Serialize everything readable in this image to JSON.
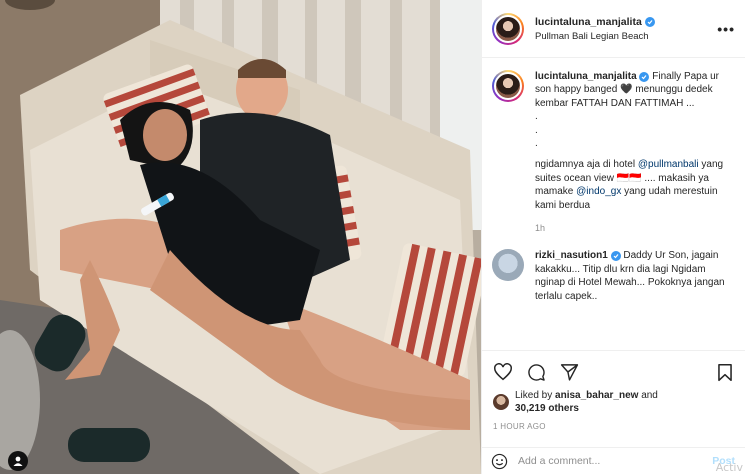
{
  "post": {
    "username": "lucintaluna_manjalita",
    "location": "Pullman Bali Legian Beach",
    "more_icon": "more-dots-icon"
  },
  "caption": {
    "username": "lucintaluna_manjalita",
    "line1": "Finally Papa ur son happy banged",
    "heart": "🖤",
    "line2": "menunggu dedek kembar FATTAH DAN FATTIMAH ...",
    "dots": [
      ".",
      ".",
      "."
    ],
    "p2_a": "ngidamnya aja di hotel",
    "mention1": "@pullmanbali",
    "p2_b": "yang suites ocean view",
    "flags": "🇮🇩🇮🇩",
    "p2_c": ".... makasih ya mamake",
    "mention2": "@indo_gx",
    "p2_d": "yang udah merestuin kami berdua",
    "time": "1h"
  },
  "comment1": {
    "username": "rizki_nasution1",
    "text": "Daddy Ur Son, jagain kakakku... Titip dlu krn dia lagi Ngidam nginap di Hotel Mewah... Pokoknya jangan terlalu capek.."
  },
  "likes": {
    "prefix": "Liked by",
    "by_user": "anisa_bahar_new",
    "and": "and",
    "count": "30,219 others"
  },
  "posted_time": "1 HOUR AGO",
  "add_comment": {
    "placeholder": "Add a comment...",
    "post_label": "Post"
  },
  "watermark": "Activ",
  "colors": {
    "verified": "#3897f0",
    "mention": "#00376b",
    "post_disabled": "#b2dffc",
    "muted": "#8e8e8e"
  }
}
